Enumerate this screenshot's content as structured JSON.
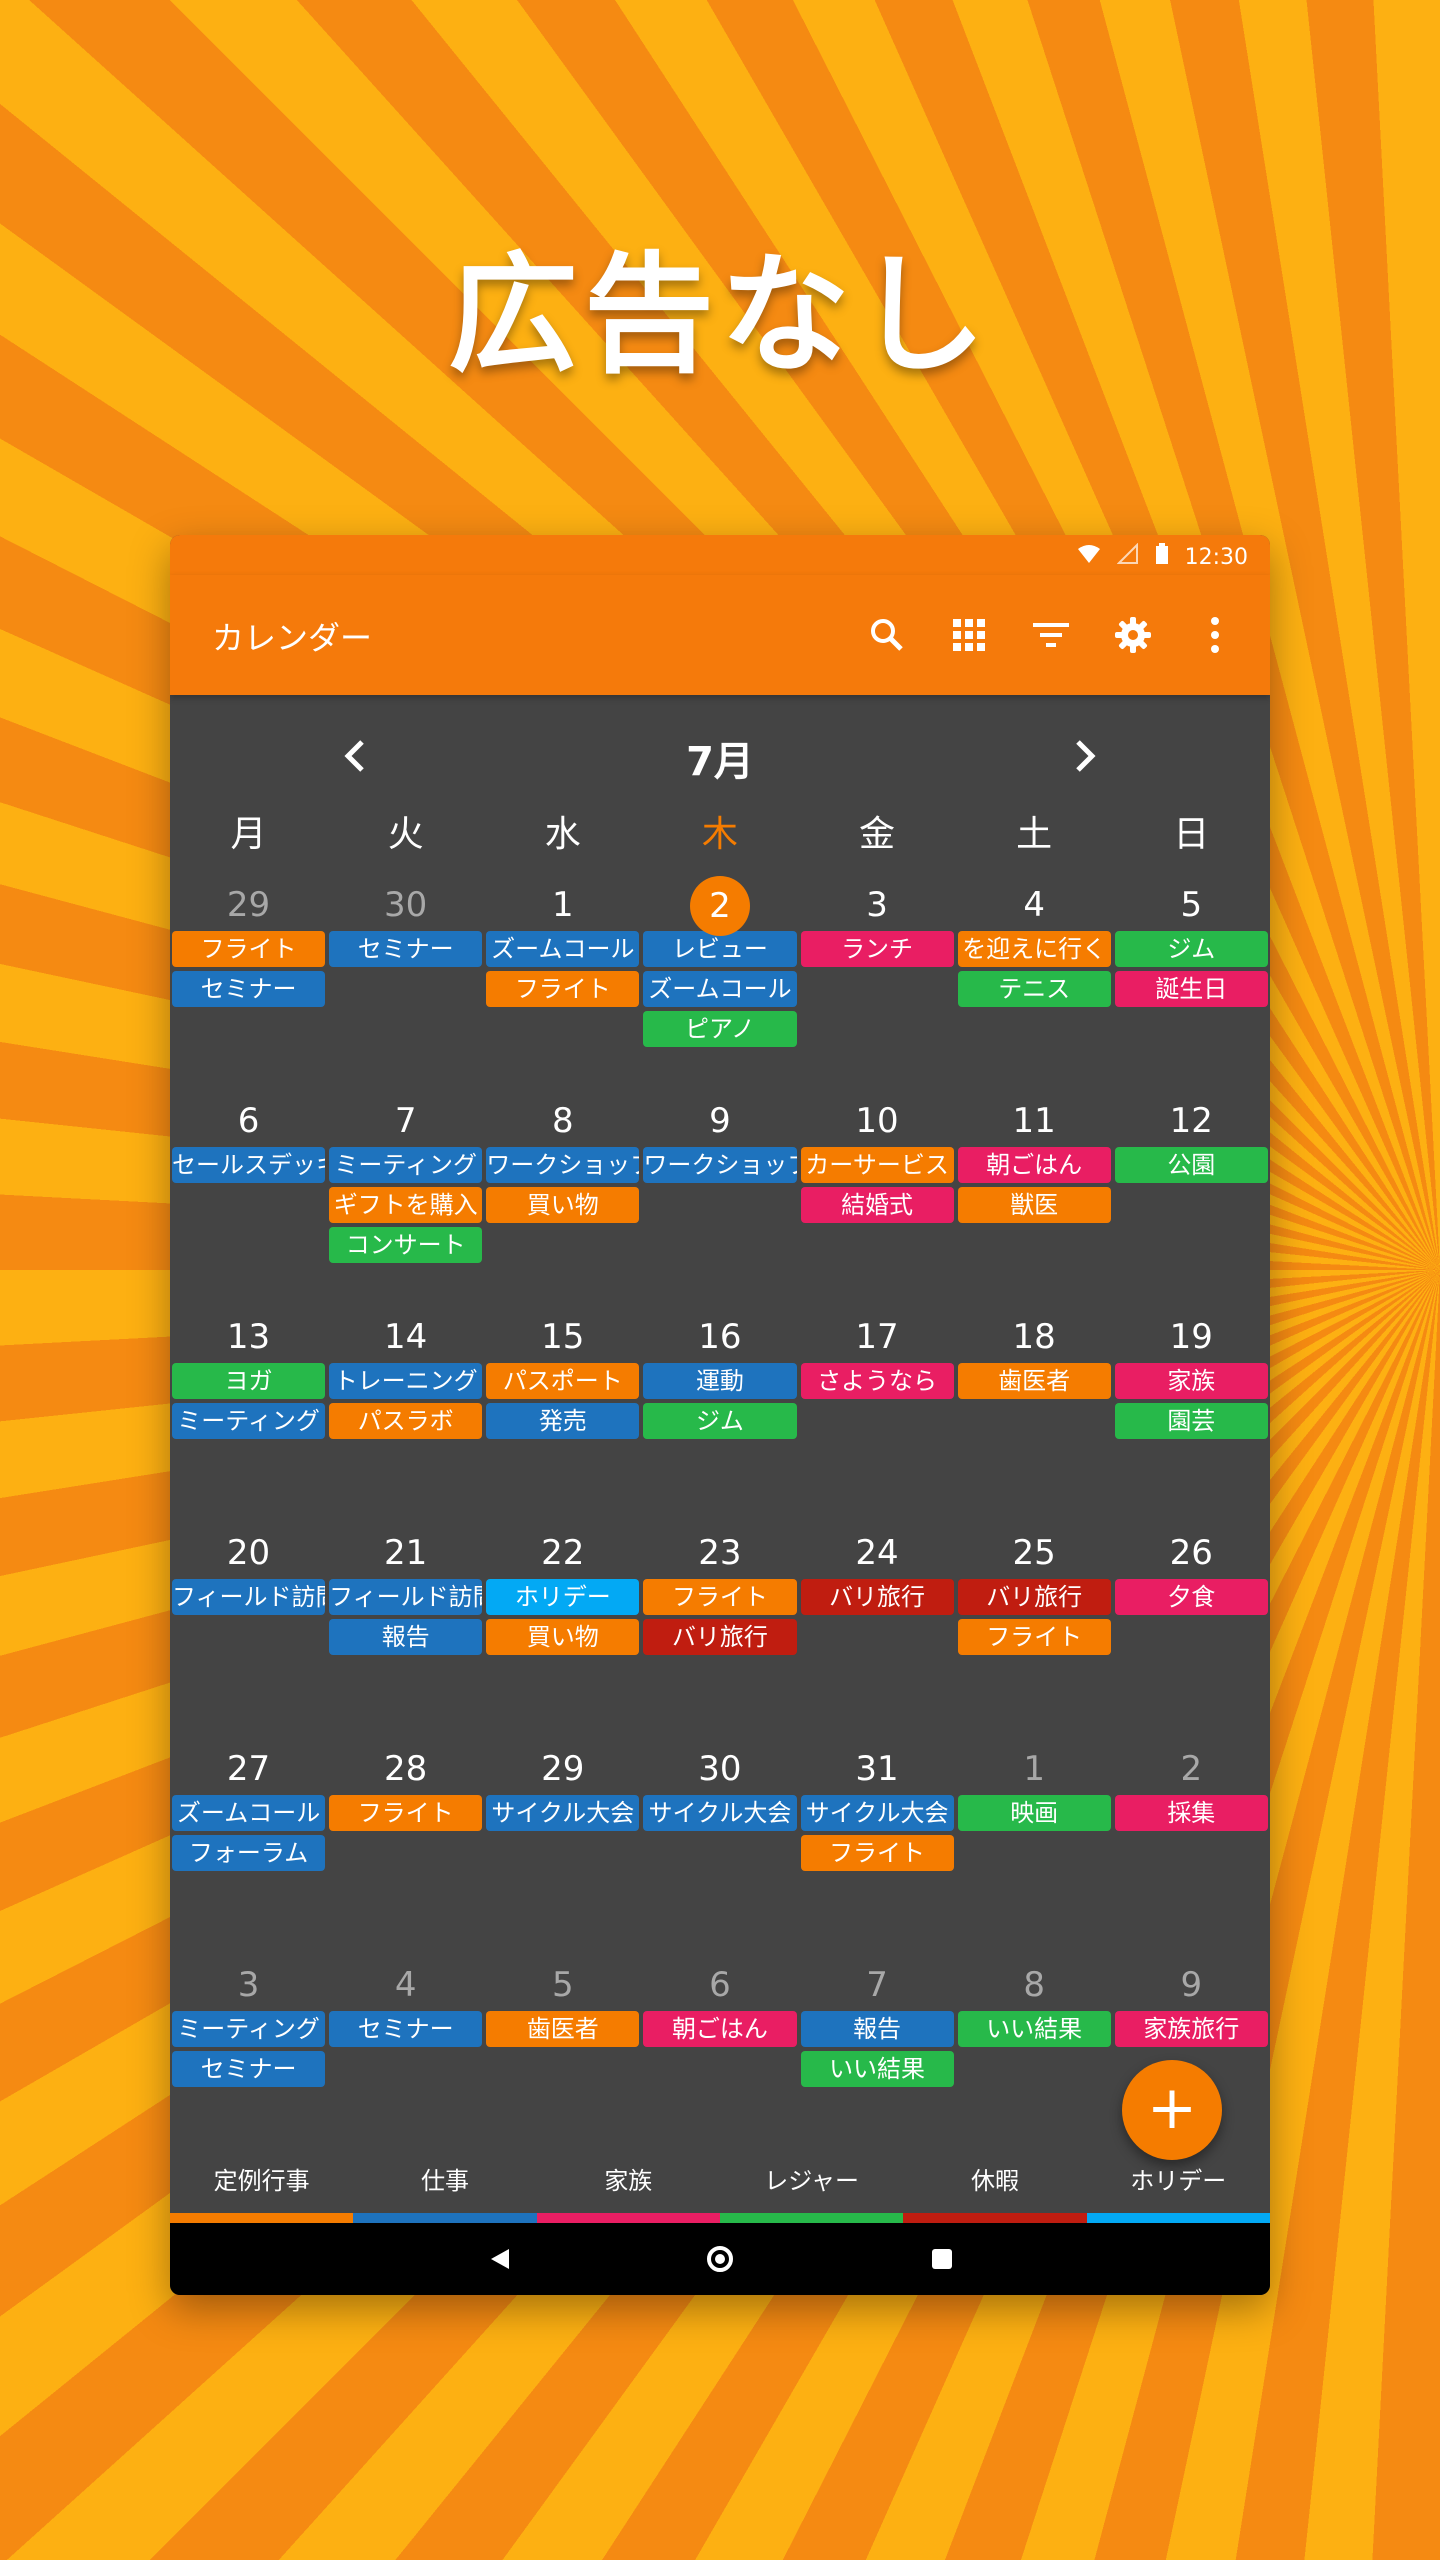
{
  "promo": {
    "headline": "広告なし"
  },
  "status_bar": {
    "time": "12:30"
  },
  "app_bar": {
    "title": "カレンダー",
    "icons": [
      "search-icon",
      "grid-icon",
      "filter-icon",
      "gear-icon",
      "more-vert-icon"
    ]
  },
  "month_nav": {
    "prev": "‹",
    "title": "7月",
    "next": "›"
  },
  "weekdays": [
    "月",
    "火",
    "水",
    "木",
    "金",
    "土",
    "日"
  ],
  "colors": {
    "accent": "#f57c00",
    "teiki": "#f57c00",
    "shigoto": "#1e73be",
    "kazoku": "#e91e63",
    "leisure": "#27b94a",
    "kyuka": "#c01d10",
    "holiday": "#03a9f4"
  },
  "weeks": [
    [
      {
        "day": "29",
        "other": true,
        "events": [
          {
            "t": "フライト",
            "c": "teiki"
          },
          {
            "t": "セミナー",
            "c": "shigoto"
          }
        ]
      },
      {
        "day": "30",
        "other": true,
        "events": [
          {
            "t": "セミナー",
            "c": "shigoto"
          }
        ]
      },
      {
        "day": "1",
        "events": [
          {
            "t": "ズームコール",
            "c": "shigoto"
          },
          {
            "t": "フライト",
            "c": "teiki"
          }
        ]
      },
      {
        "day": "2",
        "today": true,
        "events": [
          {
            "t": "レビュー",
            "c": "shigoto"
          },
          {
            "t": "ズームコール",
            "c": "shigoto"
          },
          {
            "t": "ピアノ",
            "c": "leisure"
          }
        ]
      },
      {
        "day": "3",
        "events": [
          {
            "t": "ランチ",
            "c": "kazoku"
          }
        ]
      },
      {
        "day": "4",
        "events": [
          {
            "t": "を迎えに行く",
            "c": "teiki"
          },
          {
            "t": "テニス",
            "c": "leisure"
          }
        ]
      },
      {
        "day": "5",
        "events": [
          {
            "t": "ジム",
            "c": "leisure"
          },
          {
            "t": "誕生日",
            "c": "kazoku"
          }
        ]
      }
    ],
    [
      {
        "day": "6",
        "events": [
          {
            "t": "セールスデッキ",
            "c": "shigoto"
          }
        ]
      },
      {
        "day": "7",
        "events": [
          {
            "t": "ミーティング",
            "c": "shigoto"
          },
          {
            "t": "ギフトを購入",
            "c": "teiki"
          },
          {
            "t": "コンサート",
            "c": "leisure"
          }
        ]
      },
      {
        "day": "8",
        "events": [
          {
            "t": "ワークショップ",
            "c": "shigoto"
          },
          {
            "t": "買い物",
            "c": "teiki"
          }
        ]
      },
      {
        "day": "9",
        "events": [
          {
            "t": "ワークショップ",
            "c": "shigoto"
          }
        ]
      },
      {
        "day": "10",
        "events": [
          {
            "t": "カーサービス",
            "c": "teiki"
          },
          {
            "t": "結婚式",
            "c": "kazoku"
          }
        ]
      },
      {
        "day": "11",
        "events": [
          {
            "t": "朝ごはん",
            "c": "kazoku"
          },
          {
            "t": "獣医",
            "c": "teiki"
          }
        ]
      },
      {
        "day": "12",
        "events": [
          {
            "t": "公園",
            "c": "leisure"
          }
        ]
      }
    ],
    [
      {
        "day": "13",
        "events": [
          {
            "t": "ヨガ",
            "c": "leisure"
          },
          {
            "t": "ミーティング",
            "c": "shigoto"
          }
        ]
      },
      {
        "day": "14",
        "events": [
          {
            "t": "トレーニング",
            "c": "shigoto"
          },
          {
            "t": "パスラボ",
            "c": "teiki"
          }
        ]
      },
      {
        "day": "15",
        "events": [
          {
            "t": "パスポート",
            "c": "teiki"
          },
          {
            "t": "発売",
            "c": "shigoto"
          }
        ]
      },
      {
        "day": "16",
        "events": [
          {
            "t": "運動",
            "c": "shigoto"
          },
          {
            "t": "ジム",
            "c": "leisure"
          }
        ]
      },
      {
        "day": "17",
        "events": [
          {
            "t": "さようなら",
            "c": "kazoku"
          }
        ]
      },
      {
        "day": "18",
        "events": [
          {
            "t": "歯医者",
            "c": "teiki"
          }
        ]
      },
      {
        "day": "19",
        "events": [
          {
            "t": "家族",
            "c": "kazoku"
          },
          {
            "t": "園芸",
            "c": "leisure"
          }
        ]
      }
    ],
    [
      {
        "day": "20",
        "events": [
          {
            "t": "フィールド訪問",
            "c": "shigoto"
          }
        ]
      },
      {
        "day": "21",
        "events": [
          {
            "t": "フィールド訪問",
            "c": "shigoto"
          },
          {
            "t": "報告",
            "c": "shigoto"
          }
        ]
      },
      {
        "day": "22",
        "events": [
          {
            "t": "ホリデー",
            "c": "holiday"
          },
          {
            "t": "買い物",
            "c": "teiki"
          }
        ]
      },
      {
        "day": "23",
        "events": [
          {
            "t": "フライト",
            "c": "teiki"
          },
          {
            "t": "バリ旅行",
            "c": "kyuka"
          }
        ]
      },
      {
        "day": "24",
        "events": [
          {
            "t": "バリ旅行",
            "c": "kyuka"
          }
        ]
      },
      {
        "day": "25",
        "events": [
          {
            "t": "バリ旅行",
            "c": "kyuka"
          },
          {
            "t": "フライト",
            "c": "teiki"
          }
        ]
      },
      {
        "day": "26",
        "events": [
          {
            "t": "夕食",
            "c": "kazoku"
          }
        ]
      }
    ],
    [
      {
        "day": "27",
        "events": [
          {
            "t": "ズームコール",
            "c": "shigoto"
          },
          {
            "t": "フォーラム",
            "c": "shigoto"
          }
        ]
      },
      {
        "day": "28",
        "events": [
          {
            "t": "フライト",
            "c": "teiki"
          }
        ]
      },
      {
        "day": "29",
        "events": [
          {
            "t": "サイクル大会",
            "c": "shigoto"
          }
        ]
      },
      {
        "day": "30",
        "events": [
          {
            "t": "サイクル大会",
            "c": "shigoto"
          }
        ]
      },
      {
        "day": "31",
        "events": [
          {
            "t": "サイクル大会",
            "c": "shigoto"
          },
          {
            "t": "フライト",
            "c": "teiki"
          }
        ]
      },
      {
        "day": "1",
        "other": true,
        "events": [
          {
            "t": "映画",
            "c": "leisure"
          }
        ]
      },
      {
        "day": "2",
        "other": true,
        "events": [
          {
            "t": "採集",
            "c": "kazoku"
          }
        ]
      }
    ],
    [
      {
        "day": "3",
        "other": true,
        "events": [
          {
            "t": "ミーティング",
            "c": "shigoto"
          },
          {
            "t": "セミナー",
            "c": "shigoto"
          }
        ]
      },
      {
        "day": "4",
        "other": true,
        "events": [
          {
            "t": "セミナー",
            "c": "shigoto"
          }
        ]
      },
      {
        "day": "5",
        "other": true,
        "events": [
          {
            "t": "歯医者",
            "c": "teiki"
          }
        ]
      },
      {
        "day": "6",
        "other": true,
        "events": [
          {
            "t": "朝ごはん",
            "c": "kazoku"
          }
        ]
      },
      {
        "day": "7",
        "other": true,
        "events": [
          {
            "t": "報告",
            "c": "shigoto"
          },
          {
            "t": "いい結果",
            "c": "leisure"
          }
        ]
      },
      {
        "day": "8",
        "other": true,
        "events": [
          {
            "t": "いい結果",
            "c": "leisure"
          }
        ]
      },
      {
        "day": "9",
        "other": true,
        "events": [
          {
            "t": "家族旅行",
            "c": "kazoku"
          }
        ]
      }
    ]
  ],
  "fab": {
    "label": "+"
  },
  "legend": [
    {
      "label": "定例行事",
      "c": "teiki"
    },
    {
      "label": "仕事",
      "c": "shigoto"
    },
    {
      "label": "家族",
      "c": "kazoku"
    },
    {
      "label": "レジャー",
      "c": "leisure"
    },
    {
      "label": "休暇",
      "c": "kyuka"
    },
    {
      "label": "ホリデー",
      "c": "holiday"
    }
  ]
}
